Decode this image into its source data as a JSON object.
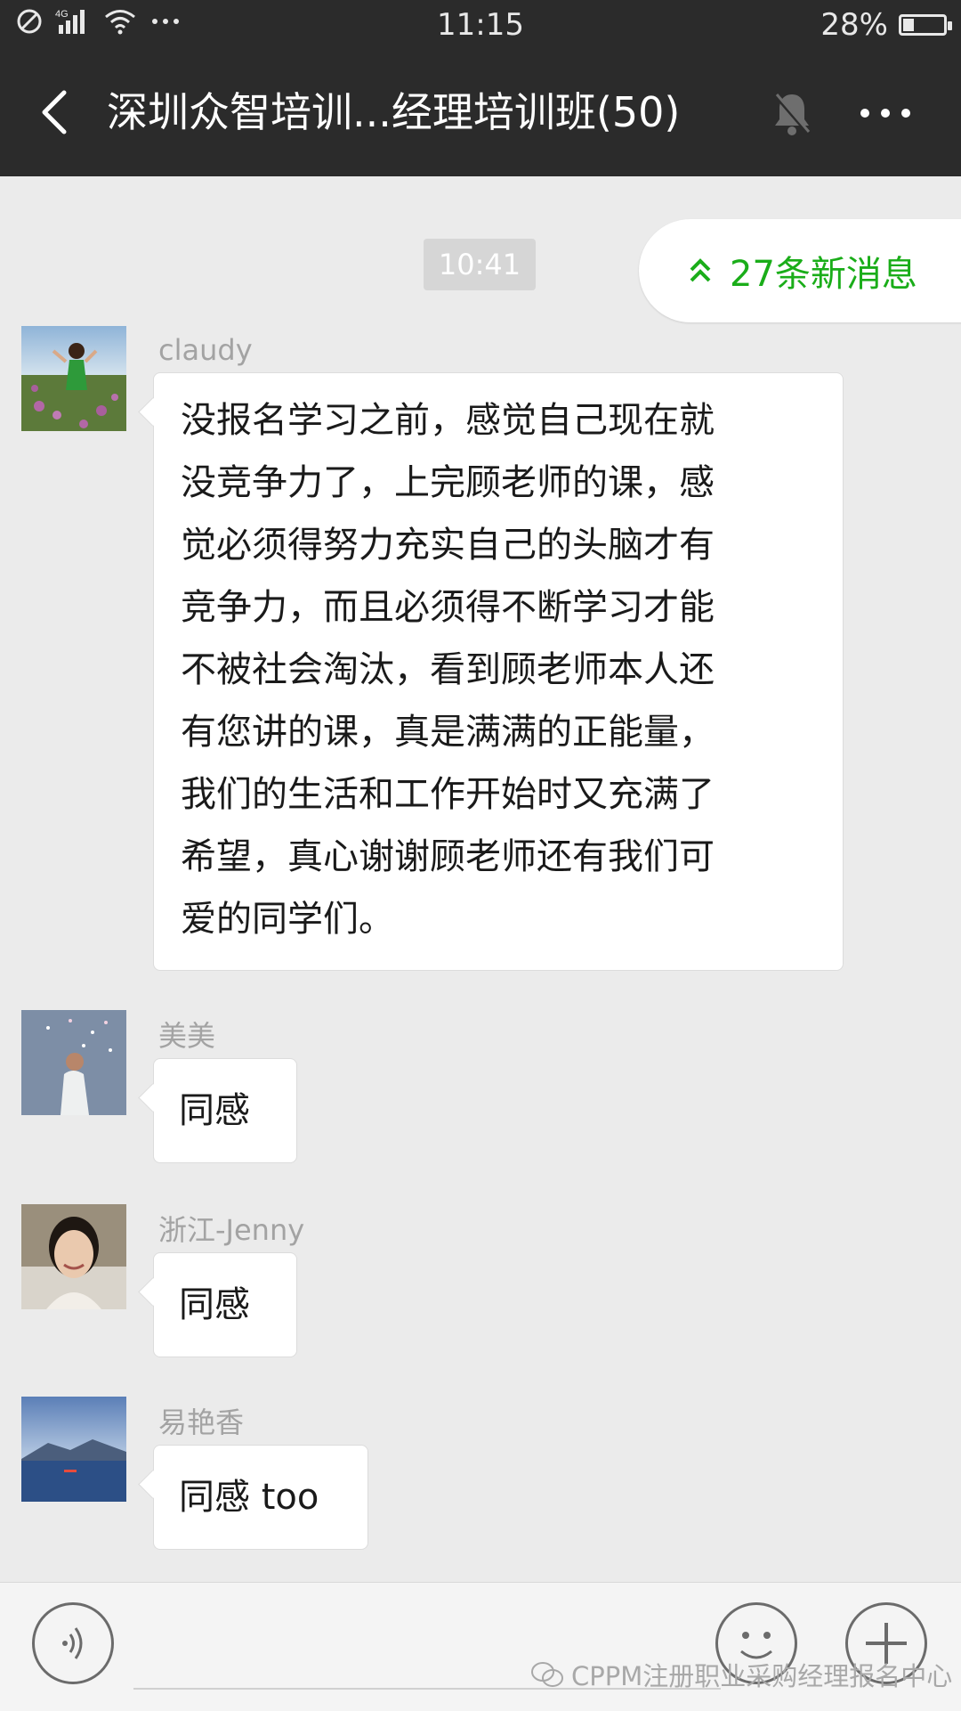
{
  "status_bar": {
    "time": "11:15",
    "battery_percent": "28%",
    "battery_level": 0.28,
    "network": "4G"
  },
  "header": {
    "title": "深圳众智培训...经理培训班(50)"
  },
  "chat": {
    "timestamp": "10:41",
    "new_messages_label": "27条新消息",
    "messages": [
      {
        "sender": "claudy",
        "lines": [
          "没报名学习之前，感觉自己现在就",
          "没竞争力了，上完顾老师的课，感",
          "觉必须得努力充实自己的头脑才有",
          "竞争力，而且必须得不断学习才能",
          "不被社会淘汰，看到顾老师本人还",
          "有您讲的课，真是满满的正能量，",
          "我们的生活和工作开始时又充满了",
          "希望，真心谢谢顾老师还有我们可",
          "爱的同学们。"
        ]
      },
      {
        "sender": "美美",
        "text": "同感"
      },
      {
        "sender": "浙江-Jenny",
        "text": "同感"
      },
      {
        "sender": "易艳香",
        "text": "同感 too"
      }
    ]
  },
  "watermark": "CPPM注册职业采购经理报名中心",
  "colors": {
    "header_bg": "#2b2b2b",
    "chat_bg": "#ebebeb",
    "accent_green": "#1aad19"
  }
}
